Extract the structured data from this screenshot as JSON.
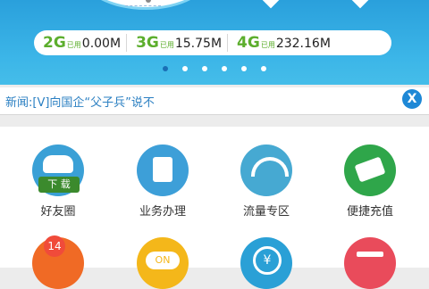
{
  "usage": {
    "items": [
      {
        "net": "2G",
        "sub": "已用",
        "value": "0.00M"
      },
      {
        "net": "3G",
        "sub": "已用",
        "value": "15.75M"
      },
      {
        "net": "4G",
        "sub": "已用",
        "value": "232.16M"
      }
    ]
  },
  "carousel": {
    "count": 6,
    "active_index": 0
  },
  "news": {
    "text": "新闻:[V]向国企“父子兵”说不"
  },
  "close_label": "X",
  "tiles": [
    {
      "label": "好友圈",
      "badge": "下 载",
      "color": "#3aa0d6"
    },
    {
      "label": "业务办理",
      "color": "#3d9fd8"
    },
    {
      "label": "流量专区",
      "color": "#46a9d2"
    },
    {
      "label": "便捷充值",
      "color": "#2fa64a"
    }
  ],
  "row2": [
    {
      "badge": "14",
      "color": "#f06a25"
    },
    {
      "icon_text": "ON",
      "color": "#f4b71a"
    },
    {
      "icon_text": "¥",
      "color": "#2aa0d6"
    },
    {
      "color": "#e94b5b"
    }
  ]
}
